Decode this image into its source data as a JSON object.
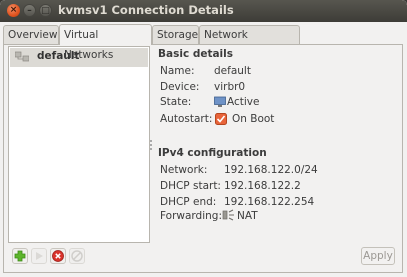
{
  "window": {
    "title": "kvmsv1 Connection Details"
  },
  "tabs": [
    {
      "label": "Overview"
    },
    {
      "label": "Virtual Networks"
    },
    {
      "label": "Storage"
    },
    {
      "label": "Network Interfaces"
    }
  ],
  "networks": [
    {
      "label": "default",
      "icon": "network-icon"
    }
  ],
  "toolbar": {
    "buttons": [
      "add-network",
      "start-network",
      "stop-network",
      "delete-network"
    ]
  },
  "details": {
    "basic_header": "Basic details",
    "name_label": "Name:",
    "name_value": "default",
    "device_label": "Device:",
    "device_value": "virbr0",
    "state_label": "State:",
    "state_value": "Active",
    "autostart_label": "Autostart:",
    "autostart_value": "On Boot",
    "ipv4_header": "IPv4 configuration",
    "network_label": "Network:",
    "network_value": "192.168.122.0/24",
    "dhcp_start_label": "DHCP start:",
    "dhcp_start_value": "192.168.122.2",
    "dhcp_end_label": "DHCP end:",
    "dhcp_end_value": "192.168.122.254",
    "forwarding_label": "Forwarding:",
    "forwarding_value": "NAT"
  },
  "apply_label": "Apply",
  "colors": {
    "titlebar": "#3d3c37",
    "close": "#e0531f",
    "selected_row": "#dcdad5",
    "checkbox": "#e8643a"
  }
}
